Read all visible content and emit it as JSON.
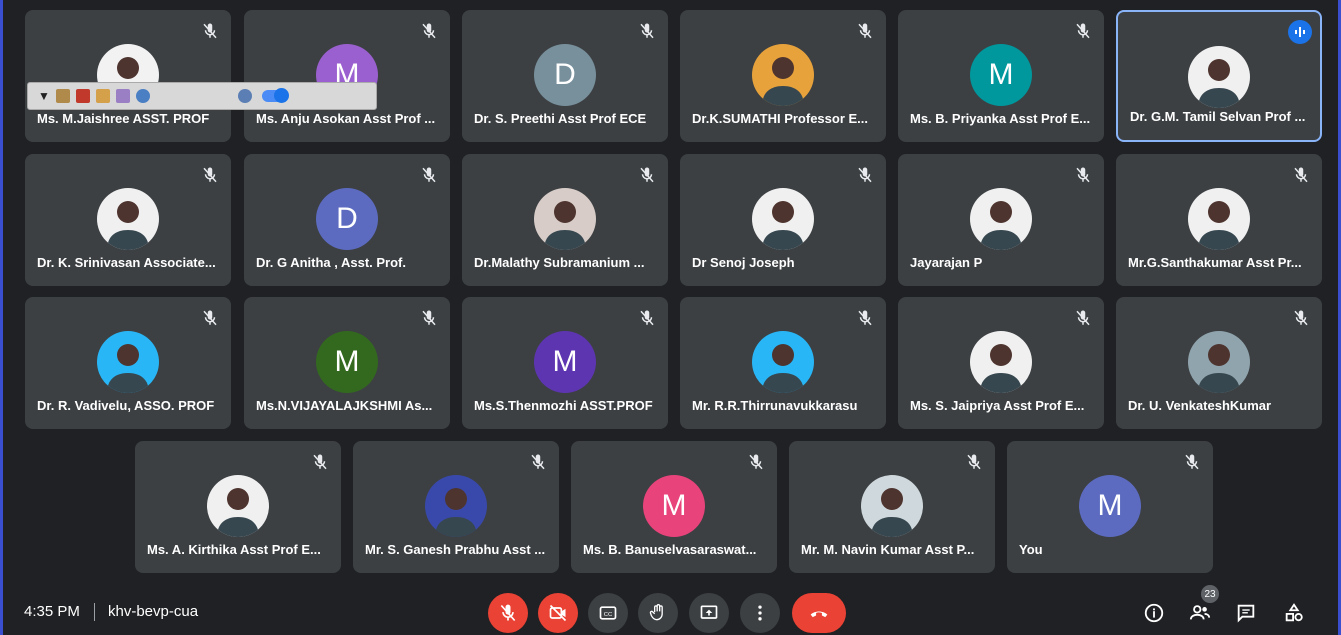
{
  "participants": [
    {
      "name": "Ms. M.Jaishree ASST. PROF",
      "avatar": "photo",
      "color": "#f2f2f2"
    },
    {
      "name": "Ms. Anju Asokan Asst Prof ...",
      "avatar": "M",
      "color": "#9a60cf"
    },
    {
      "name": "Dr. S. Preethi Asst Prof ECE",
      "avatar": "D",
      "color": "#78909c"
    },
    {
      "name": "Dr.K.SUMATHI Professor E...",
      "avatar": "photo",
      "color": "#e8a23c"
    },
    {
      "name": "Ms. B. Priyanka Asst Prof E...",
      "avatar": "M",
      "color": "#00979d"
    },
    {
      "name": "Dr. G.M. Tamil Selvan Prof ...",
      "avatar": "photo",
      "color": "#f0f0f0"
    },
    {
      "name": "Dr. K. Srinivasan Associate...",
      "avatar": "photo",
      "color": "#f0f0f0"
    },
    {
      "name": "Dr. G Anitha , Asst. Prof.",
      "avatar": "D",
      "color": "#5c6bc0"
    },
    {
      "name": "Dr.Malathy Subramanium ...",
      "avatar": "photo",
      "color": "#d7ccc8"
    },
    {
      "name": "Dr Senoj Joseph",
      "avatar": "photo",
      "color": "#f0f0f0"
    },
    {
      "name": "Jayarajan P",
      "avatar": "photo",
      "color": "#f0f0f0"
    },
    {
      "name": "Mr.G.Santhakumar Asst Pr...",
      "avatar": "photo",
      "color": "#f0f0f0"
    },
    {
      "name": "Dr. R. Vadivelu, ASSO. PROF",
      "avatar": "photo",
      "color": "#29b6f6"
    },
    {
      "name": "Ms.N.VIJAYALAJKSHMI As...",
      "avatar": "M",
      "color": "#33691e"
    },
    {
      "name": "Ms.S.Thenmozhi ASST.PROF",
      "avatar": "M",
      "color": "#5e35b1"
    },
    {
      "name": "Mr. R.R.Thirrunavukkarasu",
      "avatar": "photo",
      "color": "#29b6f6"
    },
    {
      "name": "Ms. S. Jaipriya Asst Prof E...",
      "avatar": "photo",
      "color": "#f0f0f0"
    },
    {
      "name": "Dr. U. VenkateshKumar",
      "avatar": "photo",
      "color": "#90a4ae"
    },
    {
      "name": "Ms. A. Kirthika Asst Prof E...",
      "avatar": "photo",
      "color": "#f0f0f0"
    },
    {
      "name": "Mr. S. Ganesh Prabhu Asst ...",
      "avatar": "photo",
      "color": "#3949ab"
    },
    {
      "name": "Ms. B. Banuselvasaraswat...",
      "avatar": "M",
      "color": "#e8437a"
    },
    {
      "name": "Mr. M. Navin Kumar Asst P...",
      "avatar": "photo",
      "color": "#cfd8dc"
    },
    {
      "name": "You",
      "avatar": "M",
      "color": "#5c6bc0"
    }
  ],
  "active_speaker_index": 5,
  "meeting": {
    "time": "4:35 PM",
    "code": "khv-bevp-cua",
    "participant_count": "23"
  },
  "colors": {
    "background": "#202124",
    "tile": "#3c4043",
    "red": "#ea4335",
    "accent": "#1a73e8"
  }
}
